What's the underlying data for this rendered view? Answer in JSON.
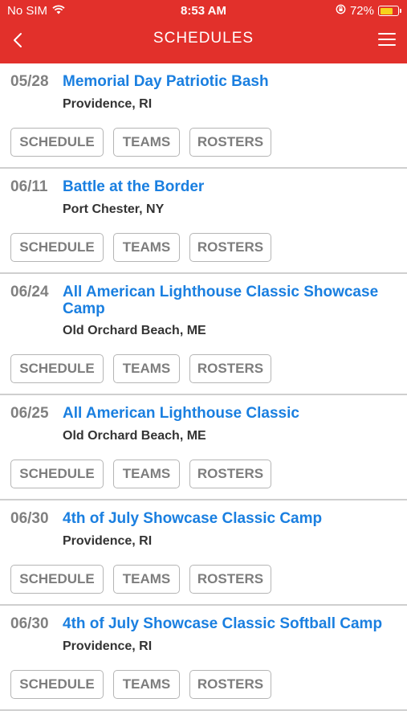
{
  "status_bar": {
    "carrier": "No SIM",
    "time": "8:53 AM",
    "battery_percent": "72%",
    "battery_level": 0.72
  },
  "nav": {
    "title": "SCHEDULES",
    "back_icon": "chevron-left-icon",
    "menu_icon": "hamburger-menu-icon"
  },
  "buttons": {
    "schedule": "SCHEDULE",
    "teams": "TEAMS",
    "rosters": "ROSTERS"
  },
  "events": [
    {
      "date": "05/28",
      "name": "Memorial Day Patriotic Bash",
      "location": "Providence, RI"
    },
    {
      "date": "06/11",
      "name": "Battle at the Border",
      "location": "Port Chester, NY"
    },
    {
      "date": "06/24",
      "name": "All American Lighthouse Classic Showcase Camp",
      "location": "Old Orchard Beach, ME"
    },
    {
      "date": "06/25",
      "name": "All American Lighthouse Classic",
      "location": "Old Orchard Beach, ME"
    },
    {
      "date": "06/30",
      "name": "4th of July Showcase Classic Camp",
      "location": "Providence, RI"
    },
    {
      "date": "06/30",
      "name": "4th of July Showcase Classic Softball Camp",
      "location": "Providence, RI"
    }
  ],
  "colors": {
    "header": "#e2302b",
    "event_link": "#1a7fe0",
    "date": "#808080",
    "button_text": "#7d7d7d"
  }
}
